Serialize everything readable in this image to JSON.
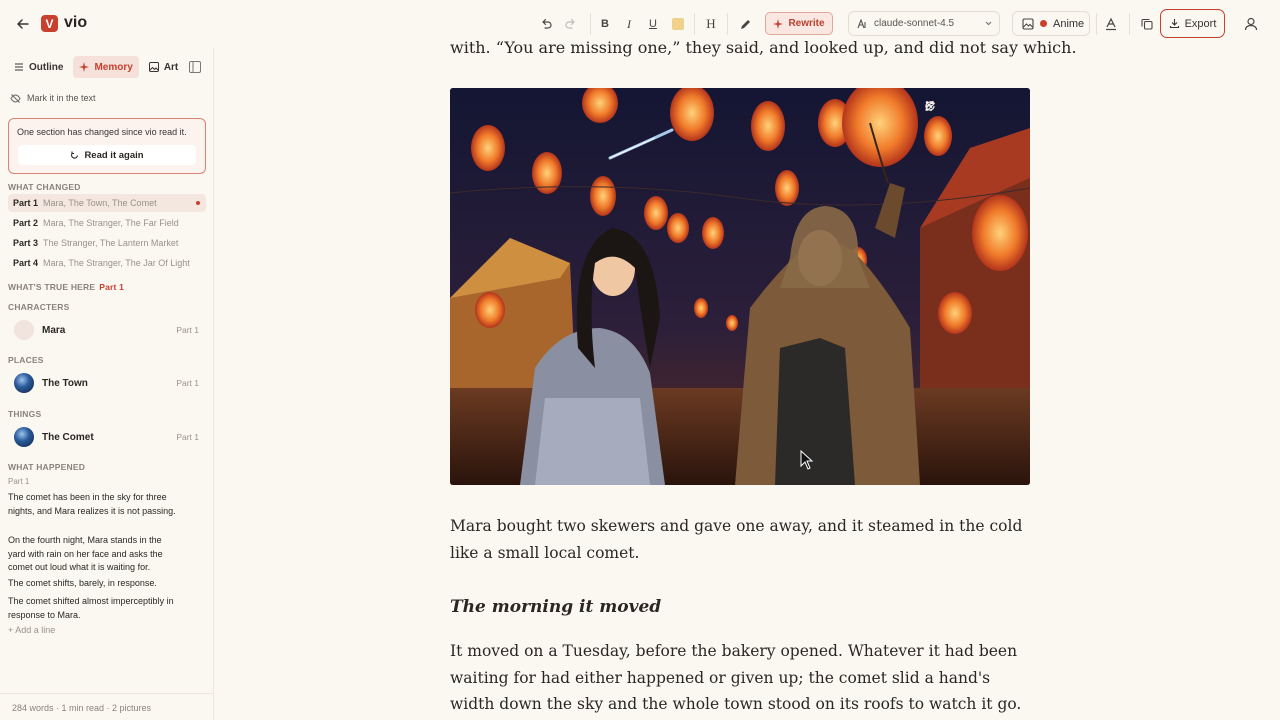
{
  "app": {
    "brand": "vio",
    "logo_letter": "V"
  },
  "toolbar": {
    "bold": "B",
    "italic": "I",
    "underline": "U",
    "heading": "H",
    "rewrite_label": "Rewrite",
    "model": "claude-sonnet-4.5",
    "style_label": "Anime",
    "export_label": "Export"
  },
  "sidebar": {
    "tabs": [
      {
        "label": "Outline"
      },
      {
        "label": "Memory"
      },
      {
        "label": "Art"
      }
    ],
    "mark_label": "Mark it in the text",
    "notice": {
      "text": "One section has changed since vio read it.",
      "button": "Read it again"
    },
    "what_changed": {
      "title": "WHAT CHANGED",
      "parts": [
        {
          "label": "Part 1",
          "desc": "Mara, The Town, The Comet"
        },
        {
          "label": "Part 2",
          "desc": "Mara, The Stranger, The Far Field"
        },
        {
          "label": "Part 3",
          "desc": "The Stranger, The Lantern Market"
        },
        {
          "label": "Part 4",
          "desc": "Mara, The Stranger, The Jar Of Light"
        }
      ]
    },
    "whats_true": {
      "title": "WHAT'S TRUE HERE",
      "part": "Part 1"
    },
    "characters": {
      "title": "CHARACTERS",
      "items": [
        {
          "name": "Mara",
          "part": "Part 1"
        }
      ]
    },
    "places": {
      "title": "PLACES",
      "items": [
        {
          "name": "The Town",
          "part": "Part 1"
        }
      ]
    },
    "things": {
      "title": "THINGS",
      "items": [
        {
          "name": "The Comet",
          "part": "Part 1"
        }
      ]
    },
    "what_happened": {
      "title": "WHAT HAPPENED",
      "part": "Part 1",
      "lines": [
        "The comet has been in the sky for three nights, and Mara realizes it is not passing.",
        "On the fourth night, Mara stands in the yard with rain on her face and asks the comet out loud what it is waiting for.",
        "The comet shifts, barely, in response.",
        "The comet shifted almost imperceptibly in response to Mara."
      ],
      "add_line": "+ Add a line"
    },
    "footer": "284 words · 1 min read · 2 pictures"
  },
  "editor": {
    "top_line": "with. “You are missing one,” they said, and looked up, and did not say which.",
    "para1": "Mara bought two skewers and gave one away, and it steamed in the cold like a small local comet.",
    "heading": "The morning it moved",
    "para2": "It moved on a Tuesday, before the bakery opened. Whatever it had been waiting for had either happened or given up; the comet slid a hand's width down the sky and the whole town stood on its roofs to watch it go."
  }
}
